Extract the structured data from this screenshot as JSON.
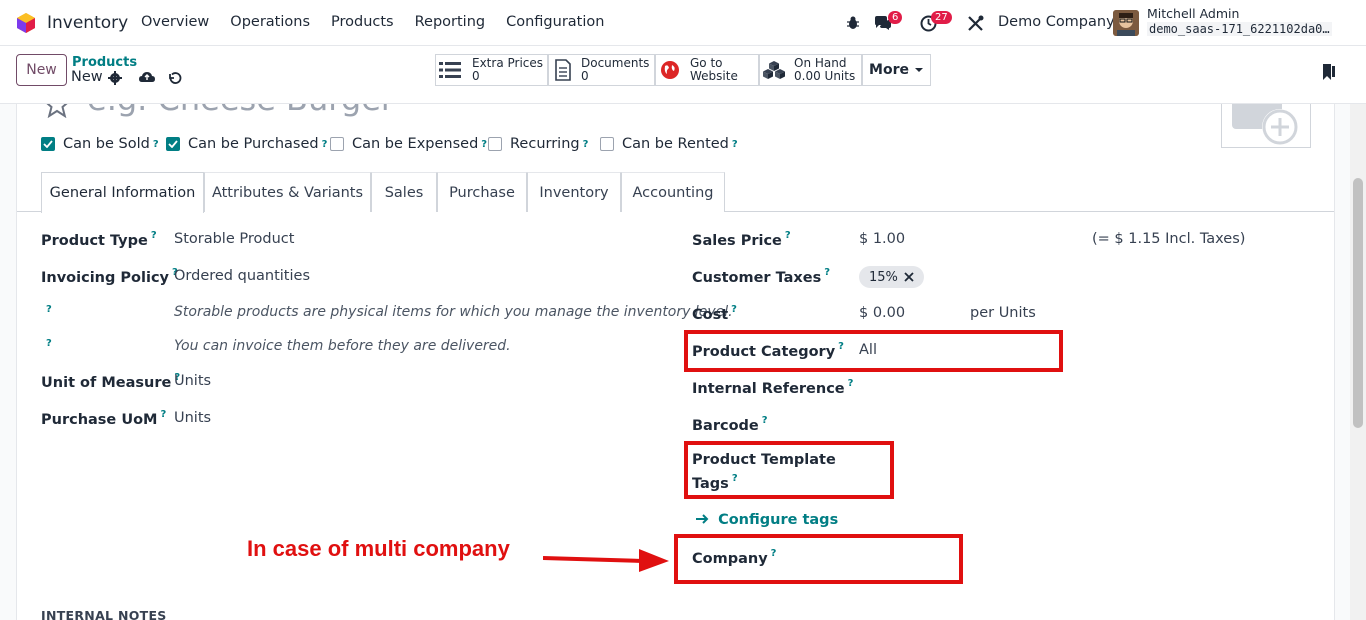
{
  "navbar": {
    "app_name": "Inventory",
    "menu": [
      "Overview",
      "Operations",
      "Products",
      "Reporting",
      "Configuration"
    ],
    "chat_count": "6",
    "activity_count": "27",
    "company": "Demo Company",
    "user_name": "Mitchell Admin",
    "db_name": "demo_saas-171_6221102da0…"
  },
  "control_panel": {
    "new_label": "New",
    "breadcrumb_parent": "Products",
    "breadcrumb_current": "New",
    "smart_buttons": [
      {
        "line1": "Extra Prices",
        "line2": "0"
      },
      {
        "line1": "Documents",
        "line2": "0"
      },
      {
        "line1": "Go to",
        "line2": "Website"
      },
      {
        "line1": "On Hand",
        "line2": "0.00 Units"
      }
    ],
    "more_label": "More"
  },
  "form": {
    "name_placeholder": "e.g. Cheese Burger",
    "checkboxes": [
      {
        "label": "Can be Sold",
        "checked": true
      },
      {
        "label": "Can be Purchased",
        "checked": true
      },
      {
        "label": "Can be Expensed",
        "checked": false
      },
      {
        "label": "Recurring",
        "checked": false
      },
      {
        "label": "Can be Rented",
        "checked": false
      }
    ],
    "tabs": [
      "General Information",
      "Attributes & Variants",
      "Sales",
      "Purchase",
      "Inventory",
      "Accounting"
    ],
    "left": {
      "product_type_label": "Product Type",
      "product_type_value": "Storable Product",
      "invoicing_policy_label": "Invoicing Policy",
      "invoicing_policy_value": "Ordered quantities",
      "help1": "Storable products are physical items for which you manage the inventory level.",
      "help2": "You can invoice them before they are delivered.",
      "uom_label": "Unit of Measure",
      "uom_value": "Units",
      "purchase_uom_label": "Purchase UoM",
      "purchase_uom_value": "Units"
    },
    "right": {
      "sales_price_label": "Sales Price",
      "sales_price_value": "$ 1.00",
      "incl_taxes": "(= $ 1.15 Incl. Taxes)",
      "customer_taxes_label": "Customer Taxes",
      "tax_tag": "15%",
      "cost_label": "Cost",
      "cost_value": "$ 0.00",
      "cost_unit": "per Units",
      "category_label": "Product Category",
      "category_value": "All",
      "internal_ref_label": "Internal Reference",
      "barcode_label": "Barcode",
      "template_tags_label_1": "Product Template",
      "template_tags_label_2": "Tags",
      "configure_tags": "Configure tags",
      "company_label": "Company"
    },
    "internal_notes_heading": "INTERNAL NOTES"
  },
  "annotation": {
    "text": "In case of multi company",
    "color": "#e01010"
  },
  "colors": {
    "primary": "#714b67",
    "link": "#017e84",
    "badge": "#e11d48"
  }
}
